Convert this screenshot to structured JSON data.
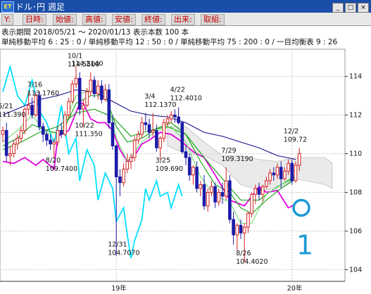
{
  "window": {
    "title": "ドル･円 週足",
    "logo": "ET"
  },
  "ohlc_labels": [
    "Y:",
    "日時:",
    "始値:",
    "高値:",
    "安値:",
    "終値:",
    "出来:",
    "取組:"
  ],
  "info": {
    "line1": "表示期間 2018/05/21 〜 2020/01/13 表示本数 100 本",
    "line2": "単純移動平均 6 : 25 : 0 / 単純移動平均 12 : 50 : 0 / 単純移動平均 75 : 200 : 0 / 一目均衡表 9 : 26"
  },
  "colors": {
    "up": "#d42020",
    "down": "#1a1aa8",
    "cyan": "#00e0ff",
    "magenta": "#e000e0",
    "navy": "#10108a",
    "green": "#10a010",
    "lime": "#6ee06e",
    "annotation": "#1e9ad6"
  },
  "annotation": {
    "label": "1"
  },
  "chart_data": {
    "type": "candlestick",
    "ylim": [
      103.4,
      115.4
    ],
    "y_ticks": [
      104,
      106,
      108,
      110,
      112,
      114
    ],
    "x_ticks": [
      "19年",
      "20年"
    ],
    "labels": [
      {
        "text": "5/21",
        "x_idx": 1,
        "y": 112.35,
        "lines": [
          "5/21",
          "111.390"
        ]
      },
      {
        "text": "7/16",
        "x_idx": 9,
        "y": 113.45,
        "lines": [
          "7/16",
          "113.1760"
        ]
      },
      {
        "text": "10/1",
        "x_idx": 20,
        "y": 114.95,
        "lines": [
          "10/1",
          "114.5500"
        ]
      },
      {
        "text": "114.2140",
        "x_idx": 21,
        "y": 114.55,
        "lines": [
          "114.2140"
        ]
      },
      {
        "text": "10/22",
        "x_idx": 22,
        "y": 111.35,
        "lines": [
          "10/22",
          "111.350"
        ]
      },
      {
        "text": "8/20",
        "x_idx": 14,
        "y": 109.55,
        "lines": [
          "8/20",
          "109.7400"
        ]
      },
      {
        "text": "12/31",
        "x_idx": 31,
        "y": 105.2,
        "lines": [
          "12/31",
          "104.7070"
        ]
      },
      {
        "text": "3/4",
        "x_idx": 41,
        "y": 112.85,
        "lines": [
          "3/4",
          "112.1370"
        ]
      },
      {
        "text": "4/22",
        "x_idx": 48,
        "y": 113.2,
        "lines": [
          "4/22",
          "112.4010"
        ]
      },
      {
        "text": "3/25",
        "x_idx": 44,
        "y": 109.55,
        "lines": [
          "3/25",
          "109.690"
        ]
      },
      {
        "text": "7/29",
        "x_idx": 62,
        "y": 110.05,
        "lines": [
          "7/29",
          "109.3190"
        ]
      },
      {
        "text": "8/26",
        "x_idx": 66,
        "y": 104.75,
        "lines": [
          "8/26",
          "104.4020"
        ]
      },
      {
        "text": "12/2",
        "x_idx": 79,
        "y": 111.05,
        "lines": [
          "12/2",
          "109.72"
        ]
      }
    ],
    "candles": [
      [
        111.0,
        111.4,
        110.6,
        111.2
      ],
      [
        111.2,
        111.6,
        109.6,
        109.9
      ],
      [
        109.9,
        110.4,
        109.4,
        110.0
      ],
      [
        110.0,
        110.7,
        109.8,
        110.5
      ],
      [
        110.5,
        111.0,
        110.2,
        110.8
      ],
      [
        110.8,
        111.4,
        110.6,
        111.2
      ],
      [
        111.2,
        112.4,
        111.0,
        112.3
      ],
      [
        112.3,
        113.2,
        112.0,
        112.5
      ],
      [
        112.5,
        112.9,
        111.8,
        112.0
      ],
      [
        112.0,
        113.2,
        111.9,
        113.0
      ],
      [
        113.0,
        113.2,
        111.2,
        111.4
      ],
      [
        111.4,
        111.6,
        110.6,
        111.0
      ],
      [
        111.0,
        111.2,
        110.4,
        110.7
      ],
      [
        110.7,
        111.0,
        110.2,
        110.5
      ],
      [
        110.5,
        110.8,
        109.8,
        110.6
      ],
      [
        110.6,
        111.4,
        110.4,
        111.2
      ],
      [
        111.2,
        111.6,
        110.8,
        111.0
      ],
      [
        111.0,
        112.2,
        110.9,
        112.0
      ],
      [
        112.0,
        112.9,
        111.8,
        112.7
      ],
      [
        112.7,
        113.8,
        112.6,
        113.6
      ],
      [
        113.6,
        114.5,
        113.4,
        113.9
      ],
      [
        113.9,
        114.2,
        112.0,
        112.3
      ],
      [
        112.3,
        112.8,
        111.4,
        112.5
      ],
      [
        112.5,
        113.4,
        112.4,
        113.2
      ],
      [
        113.2,
        114.2,
        113.0,
        113.8
      ],
      [
        113.8,
        114.0,
        112.9,
        113.1
      ],
      [
        113.1,
        113.8,
        112.8,
        113.5
      ],
      [
        113.5,
        113.8,
        112.6,
        112.8
      ],
      [
        112.8,
        113.6,
        112.7,
        113.3
      ],
      [
        113.3,
        113.6,
        111.3,
        111.6
      ],
      [
        111.6,
        112.0,
        110.2,
        110.4
      ],
      [
        110.4,
        110.5,
        104.7,
        108.8
      ],
      [
        108.8,
        109.2,
        107.8,
        108.5
      ],
      [
        108.5,
        109.5,
        108.3,
        109.2
      ],
      [
        109.2,
        110.0,
        109.0,
        109.6
      ],
      [
        109.6,
        110.0,
        109.2,
        109.8
      ],
      [
        109.8,
        110.9,
        109.6,
        110.7
      ],
      [
        110.7,
        111.2,
        110.5,
        111.0
      ],
      [
        111.0,
        111.9,
        110.8,
        111.6
      ],
      [
        111.6,
        112.1,
        111.2,
        111.5
      ],
      [
        111.5,
        111.8,
        110.8,
        111.1
      ],
      [
        111.1,
        112.1,
        110.9,
        111.2
      ],
      [
        111.2,
        111.5,
        110.1,
        110.3
      ],
      [
        110.3,
        110.9,
        109.7,
        110.8
      ],
      [
        110.8,
        111.8,
        110.6,
        111.6
      ],
      [
        111.6,
        112.0,
        111.4,
        111.8
      ],
      [
        111.8,
        112.2,
        111.6,
        112.0
      ],
      [
        112.0,
        112.3,
        111.6,
        111.9
      ],
      [
        111.9,
        112.4,
        111.5,
        111.6
      ],
      [
        111.6,
        111.7,
        110.0,
        110.1
      ],
      [
        110.1,
        110.4,
        109.4,
        109.8
      ],
      [
        109.8,
        110.0,
        108.6,
        108.9
      ],
      [
        108.9,
        109.4,
        108.4,
        109.3
      ],
      [
        109.3,
        109.6,
        108.0,
        108.2
      ],
      [
        108.2,
        108.6,
        107.8,
        108.4
      ],
      [
        108.4,
        108.9,
        107.1,
        107.3
      ],
      [
        107.3,
        108.2,
        107.0,
        108.0
      ],
      [
        108.0,
        108.6,
        107.8,
        108.3
      ],
      [
        108.3,
        108.5,
        107.2,
        107.5
      ],
      [
        107.5,
        108.2,
        107.3,
        108.0
      ],
      [
        108.0,
        108.5,
        107.4,
        107.8
      ],
      [
        107.8,
        109.3,
        107.6,
        108.6
      ],
      [
        108.6,
        108.9,
        106.4,
        106.6
      ],
      [
        106.6,
        107.0,
        105.3,
        105.8
      ],
      [
        105.8,
        106.4,
        105.0,
        106.3
      ],
      [
        106.3,
        106.6,
        105.6,
        105.9
      ],
      [
        105.9,
        106.4,
        104.4,
        106.2
      ],
      [
        106.2,
        107.0,
        105.9,
        106.9
      ],
      [
        106.9,
        108.0,
        106.7,
        107.9
      ],
      [
        107.9,
        108.4,
        107.4,
        108.2
      ],
      [
        108.2,
        108.5,
        107.6,
        107.9
      ],
      [
        107.9,
        108.4,
        107.5,
        108.3
      ],
      [
        108.3,
        108.8,
        108.2,
        108.6
      ],
      [
        108.6,
        109.2,
        108.4,
        109.0
      ],
      [
        109.0,
        109.3,
        108.6,
        108.9
      ],
      [
        108.9,
        109.5,
        108.7,
        109.3
      ],
      [
        109.3,
        109.6,
        108.2,
        108.7
      ],
      [
        108.7,
        109.3,
        108.6,
        109.1
      ],
      [
        109.1,
        109.7,
        108.9,
        109.5
      ],
      [
        109.5,
        109.7,
        108.4,
        108.6
      ],
      [
        108.6,
        109.6,
        108.5,
        109.4
      ],
      [
        109.4,
        110.3,
        109.1,
        110.0
      ]
    ],
    "series": [
      {
        "name": "cyan",
        "color_key": "cyan",
        "points": [
          [
            0,
            113.2
          ],
          [
            2,
            114.5
          ],
          [
            4,
            113.0
          ],
          [
            6,
            112.5
          ],
          [
            8,
            113.8
          ],
          [
            10,
            112.2
          ],
          [
            12,
            111.6
          ],
          [
            14,
            110.5
          ],
          [
            16,
            112.5
          ],
          [
            18,
            110.0
          ],
          [
            20,
            110.8
          ],
          [
            21,
            108.6
          ],
          [
            23,
            110.2
          ],
          [
            25,
            109.4
          ],
          [
            26,
            107.6
          ],
          [
            28,
            109.0
          ],
          [
            30,
            108.2
          ],
          [
            31,
            106.5
          ],
          [
            33,
            107.2
          ],
          [
            34,
            105.8
          ],
          [
            35,
            104.6
          ],
          [
            36,
            105.5
          ],
          [
            38,
            106.6
          ],
          [
            39,
            108.2
          ],
          [
            40,
            107.6
          ],
          [
            42,
            108.6
          ],
          [
            43,
            107.8
          ],
          [
            45,
            108.0
          ],
          [
            46,
            107.2
          ],
          [
            48,
            108.4
          ],
          [
            49,
            107.8
          ]
        ]
      },
      {
        "name": "magenta",
        "color_key": "magenta",
        "points": [
          [
            0,
            109.6
          ],
          [
            3,
            109.5
          ],
          [
            6,
            109.8
          ],
          [
            9,
            109.4
          ],
          [
            11,
            109.7
          ],
          [
            14,
            109.2
          ],
          [
            15,
            110.9
          ],
          [
            18,
            111.2
          ],
          [
            21,
            112.6
          ],
          [
            22,
            112.6
          ],
          [
            24,
            111.8
          ],
          [
            26,
            111.6
          ],
          [
            28,
            111.6
          ],
          [
            30,
            111.2
          ],
          [
            32,
            110.2
          ],
          [
            34,
            109.6
          ],
          [
            36,
            109.9
          ],
          [
            38,
            110.5
          ],
          [
            40,
            110.7
          ],
          [
            43,
            111.1
          ],
          [
            46,
            111.0
          ],
          [
            49,
            110.6
          ],
          [
            52,
            110.1
          ],
          [
            55,
            109.8
          ],
          [
            58,
            108.9
          ],
          [
            62,
            107.6
          ],
          [
            66,
            107.3
          ],
          [
            70,
            108.3
          ],
          [
            72,
            108.0
          ],
          [
            75,
            108.1
          ],
          [
            78,
            107.2
          ],
          [
            80,
            107.4
          ]
        ]
      },
      {
        "name": "navy",
        "color_key": "navy",
        "points": [
          [
            0,
            112.0
          ],
          [
            5,
            112.4
          ],
          [
            10,
            112.8
          ],
          [
            15,
            113.0
          ],
          [
            20,
            113.3
          ],
          [
            25,
            113.2
          ],
          [
            30,
            112.7
          ],
          [
            35,
            112.2
          ],
          [
            40,
            112.0
          ],
          [
            45,
            111.9
          ],
          [
            50,
            111.6
          ],
          [
            55,
            111.1
          ],
          [
            60,
            110.9
          ],
          [
            65,
            110.6
          ],
          [
            70,
            110.3
          ],
          [
            75,
            109.9
          ],
          [
            80,
            109.7
          ]
        ]
      },
      {
        "name": "green",
        "color_key": "green",
        "points": [
          [
            0,
            110.2
          ],
          [
            5,
            110.6
          ],
          [
            10,
            111.1
          ],
          [
            15,
            111.4
          ],
          [
            20,
            112.1
          ],
          [
            25,
            112.3
          ],
          [
            30,
            111.9
          ],
          [
            35,
            110.9
          ],
          [
            40,
            111.2
          ],
          [
            45,
            111.4
          ],
          [
            50,
            111.0
          ],
          [
            55,
            109.8
          ],
          [
            60,
            108.7
          ],
          [
            65,
            107.6
          ],
          [
            70,
            107.6
          ],
          [
            75,
            108.3
          ],
          [
            80,
            108.8
          ]
        ]
      },
      {
        "name": "lime",
        "color_key": "lime",
        "points": [
          [
            0,
            110.6
          ],
          [
            4,
            111.2
          ],
          [
            8,
            112.0
          ],
          [
            12,
            111.0
          ],
          [
            16,
            111.2
          ],
          [
            20,
            113.0
          ],
          [
            24,
            113.3
          ],
          [
            28,
            113.2
          ],
          [
            31,
            110.8
          ],
          [
            34,
            109.6
          ],
          [
            38,
            110.6
          ],
          [
            42,
            111.2
          ],
          [
            46,
            111.4
          ],
          [
            50,
            110.6
          ],
          [
            54,
            108.8
          ],
          [
            58,
            107.8
          ],
          [
            62,
            107.5
          ],
          [
            65,
            106.4
          ],
          [
            68,
            106.4
          ],
          [
            72,
            107.9
          ],
          [
            76,
            108.4
          ],
          [
            80,
            108.9
          ]
        ]
      },
      {
        "name": "darkgreen",
        "color_key": "green",
        "points": [
          [
            0,
            110.4
          ],
          [
            4,
            110.8
          ],
          [
            8,
            111.5
          ],
          [
            12,
            111.2
          ],
          [
            16,
            111.0
          ],
          [
            20,
            112.6
          ],
          [
            24,
            113.0
          ],
          [
            28,
            113.0
          ],
          [
            31,
            111.4
          ],
          [
            34,
            110.6
          ],
          [
            38,
            110.8
          ],
          [
            42,
            111.3
          ],
          [
            46,
            111.6
          ],
          [
            50,
            111.0
          ],
          [
            54,
            109.6
          ],
          [
            58,
            108.4
          ],
          [
            62,
            108.0
          ],
          [
            65,
            107.2
          ],
          [
            68,
            106.9
          ],
          [
            72,
            107.6
          ],
          [
            76,
            108.2
          ],
          [
            80,
            108.7
          ]
        ]
      }
    ],
    "cloud_top": [
      [
        45,
        111.4
      ],
      [
        50,
        111.4
      ],
      [
        55,
        110.6
      ],
      [
        60,
        109.9
      ],
      [
        65,
        109.9
      ],
      [
        70,
        109.7
      ],
      [
        75,
        109.6
      ],
      [
        80,
        109.8
      ],
      [
        88,
        109.8
      ],
      [
        90,
        109.5
      ]
    ],
    "cloud_bottom": [
      [
        45,
        110.4
      ],
      [
        50,
        110.0
      ],
      [
        55,
        109.9
      ],
      [
        60,
        109.4
      ],
      [
        65,
        108.4
      ],
      [
        70,
        108.1
      ],
      [
        75,
        108.2
      ],
      [
        80,
        108.7
      ],
      [
        88,
        108.4
      ],
      [
        90,
        108.2
      ]
    ]
  }
}
